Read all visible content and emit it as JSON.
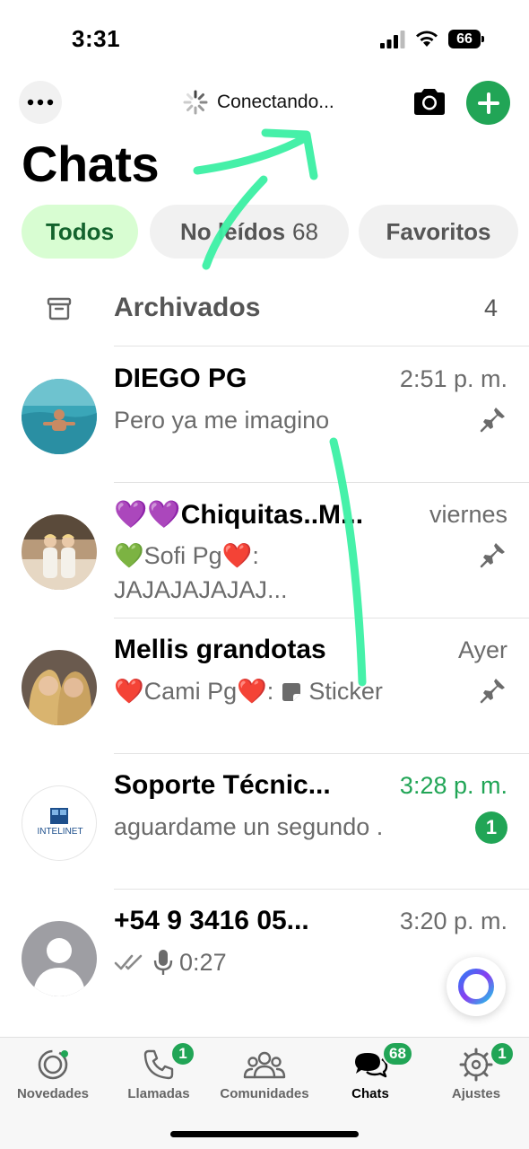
{
  "status_bar": {
    "time": "3:31",
    "battery": "66"
  },
  "header": {
    "connecting_label": "Conectando...",
    "title": "Chats"
  },
  "filters": [
    {
      "label": "Todos",
      "count": ""
    },
    {
      "label": "No leídos",
      "count": "68"
    },
    {
      "label": "Favoritos",
      "count": ""
    }
  ],
  "archived": {
    "label": "Archivados",
    "count": "4"
  },
  "chats": [
    {
      "name": "DIEGO PG",
      "time": "2:51 p. m.",
      "preview": "Pero ya me imagino",
      "pinned": true
    },
    {
      "name": "💜💜Chiquitas..M...",
      "time": "viernes",
      "preview_sender": "Sofi Pg",
      "preview_text": "JAJAJAJAJAJ...",
      "pinned": true
    },
    {
      "name": "Mellis grandotas",
      "time": "Ayer",
      "preview_sender": "Cami Pg",
      "preview_text": "Sticker",
      "pinned": true
    },
    {
      "name": "Soporte Técnic...",
      "time": "3:28 p. m.",
      "preview": "aguardame un segundo .",
      "unread": "1"
    },
    {
      "name": "+54 9 3416 05...",
      "time": "3:20 p. m.",
      "preview_text": "0:27"
    }
  ],
  "logo_text": "INTELINET",
  "tabs": [
    {
      "label": "Novedades",
      "badge": ""
    },
    {
      "label": "Llamadas",
      "badge": "1"
    },
    {
      "label": "Comunidades",
      "badge": ""
    },
    {
      "label": "Chats",
      "badge": "68"
    },
    {
      "label": "Ajustes",
      "badge": "1"
    }
  ],
  "colors": {
    "accent": "#21a556",
    "chip_active_bg": "#d8fdd2",
    "annotation": "#3cf0a4"
  }
}
